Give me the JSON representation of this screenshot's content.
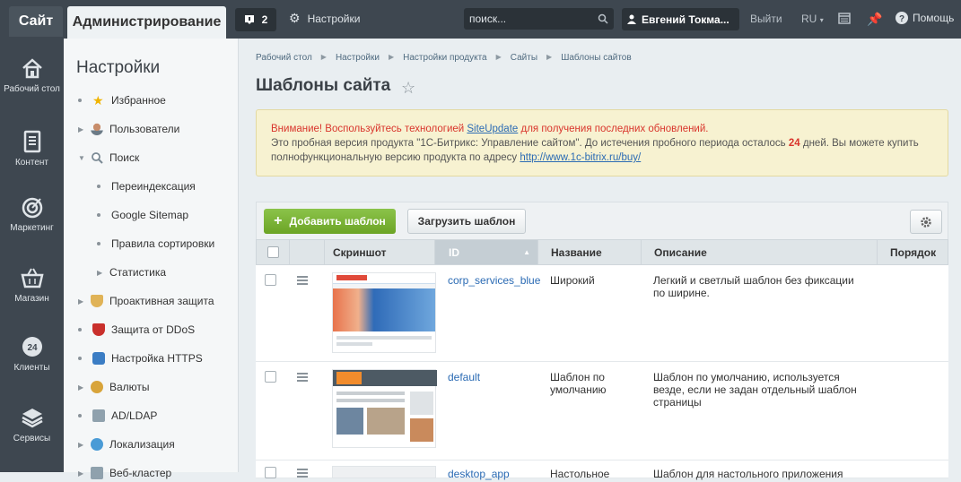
{
  "topbar": {
    "site_tab": "Сайт",
    "admin_tab": "Администрирование",
    "notifications_count": "2",
    "settings_label": "Настройки",
    "search_placeholder": "поиск...",
    "user_name": "Евгений Токма...",
    "exit_label": "Выйти",
    "lang_label": "RU",
    "help_label": "Помощь"
  },
  "leftnav": {
    "items": [
      {
        "label": "Рабочий стол",
        "icon": "home-icon"
      },
      {
        "label": "Контент",
        "icon": "document-icon"
      },
      {
        "label": "Маркетинг",
        "icon": "target-icon"
      },
      {
        "label": "Магазин",
        "icon": "basket-icon"
      },
      {
        "label": "Клиенты",
        "icon": "clock-24-icon"
      },
      {
        "label": "Сервисы",
        "icon": "layers-icon"
      }
    ]
  },
  "menu": {
    "title": "Настройки",
    "items": [
      {
        "label": "Избранное"
      },
      {
        "label": "Пользователи"
      },
      {
        "label": "Поиск"
      },
      {
        "label": "Переиндексация"
      },
      {
        "label": "Google Sitemap"
      },
      {
        "label": "Правила сортировки"
      },
      {
        "label": "Статистика"
      },
      {
        "label": "Проактивная защита"
      },
      {
        "label": "Защита от DDoS"
      },
      {
        "label": "Настройка HTTPS"
      },
      {
        "label": "Валюты"
      },
      {
        "label": "AD/LDAP"
      },
      {
        "label": "Локализация"
      },
      {
        "label": "Веб-кластер"
      }
    ]
  },
  "breadcrumbs": [
    "Рабочий стол",
    "Настройки",
    "Настройки продукта",
    "Сайты",
    "Шаблоны сайтов"
  ],
  "page_title": "Шаблоны сайта",
  "alert": {
    "line1_prefix": "Внимание! Воспользуйтесь технологией ",
    "line1_link": "SiteUpdate",
    "line1_suffix": " для получения последних обновлений.",
    "line2_prefix": "Это пробная версия продукта \"1С-Битрикс: Управление сайтом\". До истечения пробного периода осталось ",
    "days": "24",
    "line2_suffix": " дней. Вы можете купить",
    "line3_prefix": "полнофункциональную версию продукта по адресу ",
    "line3_link": "http://www.1c-bitrix.ru/buy/"
  },
  "toolbar": {
    "add_label": "Добавить шаблон",
    "load_label": "Загрузить шаблон"
  },
  "table": {
    "headers": {
      "screenshot": "Скриншот",
      "id": "ID",
      "name": "Название",
      "description": "Описание",
      "order": "Порядок"
    },
    "rows": [
      {
        "id": "corp_services_blue",
        "name": "Широкий",
        "description": "Легкий и светлый шаблон без фиксации по ширине."
      },
      {
        "id": "default",
        "name": "Шаблон по умолчанию",
        "description": "Шаблон по умолчанию, используется везде, если не задан отдельный шаблон страницы"
      },
      {
        "id": "desktop_app",
        "name": "Настольное",
        "description": "Шаблон для настольного приложения"
      }
    ]
  },
  "colors": {
    "topbar": "#3e4750",
    "accent_green": "#7cb342",
    "link": "#2b6bb4",
    "alert_bg": "#f7f2d1",
    "alert_red": "#d9352c"
  }
}
